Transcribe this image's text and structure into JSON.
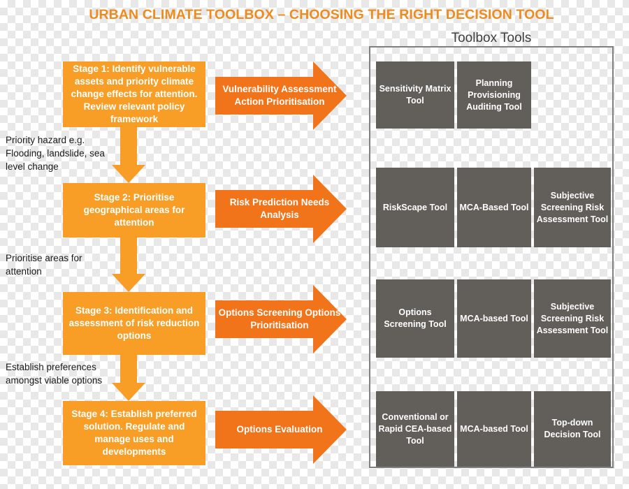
{
  "title": "URBAN CLIMATE TOOLBOX – CHOOSING THE RIGHT DECISION TOOL",
  "toolbox": {
    "heading": "Toolbox Tools",
    "rows": [
      {
        "tools": [
          "Sensitivity Matrix Tool",
          "Planning Provisioning Auditing Tool"
        ]
      },
      {
        "tools": [
          "RiskScape Tool",
          "MCA-Based Tool",
          "Subjective Screening Risk Assessment Tool"
        ]
      },
      {
        "tools": [
          "Options Screening Tool",
          "MCA-based Tool",
          "Subjective Screening Risk Assessment Tool"
        ]
      },
      {
        "tools": [
          "Conventional or Rapid CEA-based Tool",
          "MCA-based Tool",
          "Top-down Decision Tool"
        ]
      }
    ]
  },
  "stages": [
    {
      "label": "Stage 1: Identify vulnerable assets and priority climate change effects for attention.  Review relevant policy framework",
      "arrow_label": "Vulnerability Assessment Action Prioritisation"
    },
    {
      "label": "Stage 2: Prioritise geographical areas for attention",
      "arrow_label": "Risk Prediction Needs Analysis"
    },
    {
      "label": "Stage 3: Identification and assessment of risk reduction options",
      "arrow_label": "Options Screening Options Prioritisation"
    },
    {
      "label": "Stage 4: Establish preferred solution.  Regulate and manage uses and developments",
      "arrow_label": "Options Evaluation"
    }
  ],
  "notes": [
    "Priority hazard e.g. Flooding, landslide, sea level change",
    "Prioritise areas for attention",
    "Establish preferences amongst viable options"
  ],
  "colors": {
    "title": "#ED8B1F",
    "stage_box": "#F89E27",
    "arrow": "#F2741A",
    "tool_box": "#625F5A",
    "frame": "#808080"
  }
}
